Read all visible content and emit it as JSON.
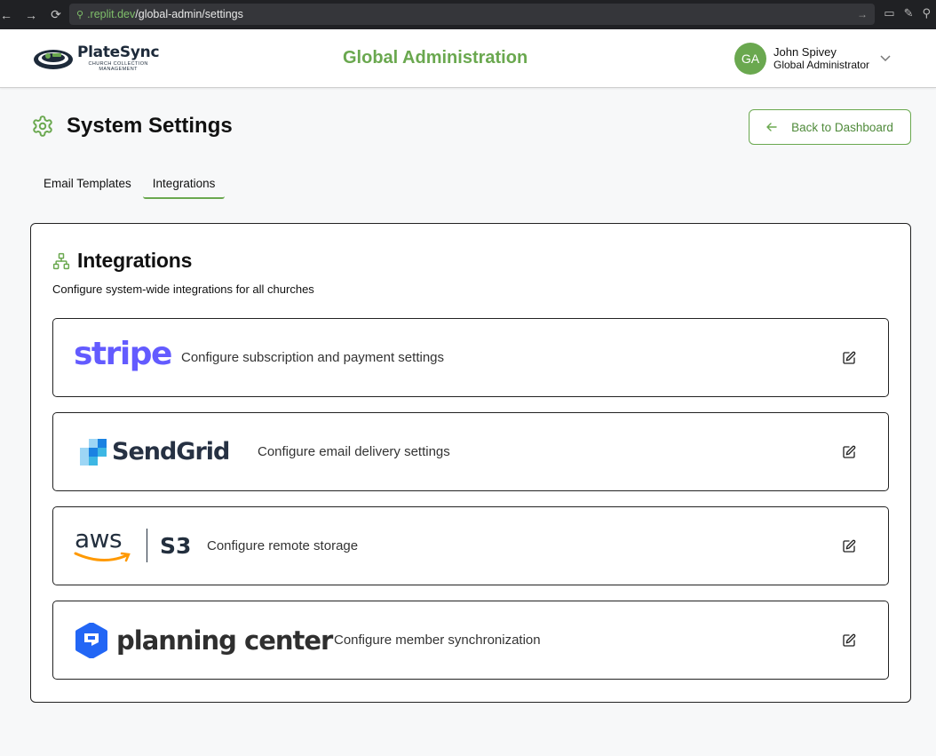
{
  "browser": {
    "url_host": ".replit.dev",
    "url_path": "/global-admin/settings"
  },
  "header": {
    "logo_name": "PlateSync",
    "logo_tagline_1": "CHURCH COLLECTION",
    "logo_tagline_2": "MANAGEMENT",
    "title": "Global Administration",
    "user": {
      "initials": "GA",
      "name": "John Spivey",
      "role": "Global Administrator"
    }
  },
  "page": {
    "title": "System Settings",
    "back_label": "Back to Dashboard"
  },
  "tabs": [
    {
      "label": "Email Templates",
      "active": false
    },
    {
      "label": "Integrations",
      "active": true
    }
  ],
  "card": {
    "title": "Integrations",
    "subtitle": "Configure system-wide integrations for all churches",
    "integrations": [
      {
        "logo_text": "stripe",
        "description": "Configure subscription and payment settings"
      },
      {
        "logo_text": "SendGrid",
        "description": "Configure email delivery settings"
      },
      {
        "logo_text": "aws",
        "logo_text_2": "S3",
        "description": "Configure remote storage"
      },
      {
        "logo_text": "planning center",
        "description": "Configure member synchronization"
      }
    ]
  },
  "colors": {
    "accent": "#6aa84f",
    "stripe": "#635bff",
    "aws_orange": "#ff9900",
    "pc_blue": "#2266f5"
  }
}
